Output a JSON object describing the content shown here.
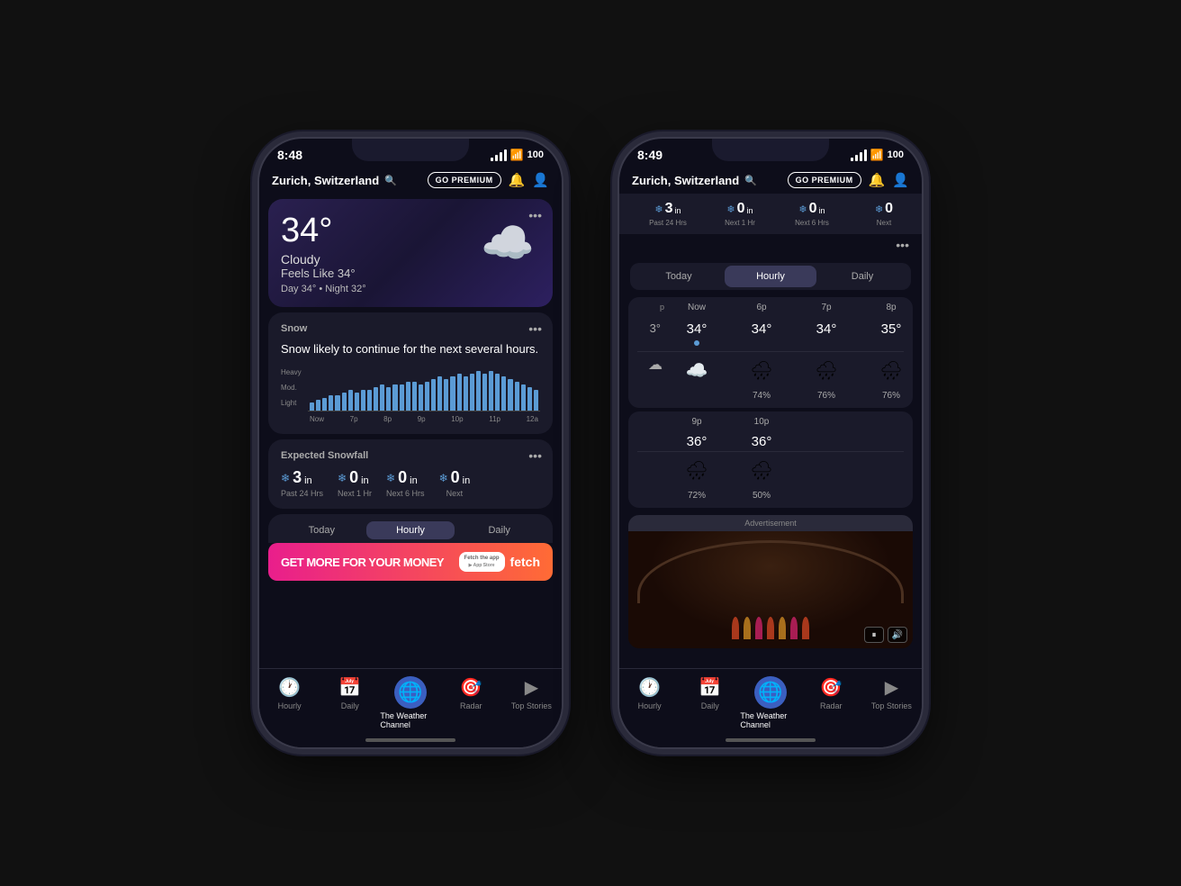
{
  "phone1": {
    "status": {
      "time": "8:48",
      "battery": "100"
    },
    "header": {
      "location": "Zurich, Switzerland",
      "premium_label": "GO PREMIUM"
    },
    "weather": {
      "temperature": "34°",
      "condition": "Cloudy",
      "feels_like": "Feels Like 34°",
      "day_temp": "Day 34°",
      "night_temp": "Night 32°"
    },
    "snow_alert": {
      "title": "Snow",
      "description": "Snow likely to continue for the next several hours."
    },
    "chart": {
      "y_labels": [
        "Heavy",
        "Mod.",
        "Light"
      ],
      "x_labels": [
        "Now",
        "7p",
        "8p",
        "9p",
        "10p",
        "11p",
        "12a"
      ],
      "bars": [
        3,
        4,
        5,
        6,
        6,
        7,
        8,
        7,
        8,
        8,
        9,
        10,
        9,
        10,
        10,
        11,
        11,
        10,
        11,
        12,
        13,
        12,
        13,
        14,
        13,
        14,
        15,
        14,
        15,
        14,
        13,
        12,
        11,
        10,
        9,
        8
      ]
    },
    "snowfall": {
      "title": "Expected Snowfall",
      "amounts": [
        {
          "value": "3",
          "unit": "in",
          "label": "Past 24 Hrs"
        },
        {
          "value": "0",
          "unit": "in",
          "label": "Next 1 Hr"
        },
        {
          "value": "0",
          "unit": "in",
          "label": "Next 6 Hrs"
        },
        {
          "value": "0",
          "unit": "in",
          "label": "Next"
        }
      ]
    },
    "tabs": {
      "items": [
        "Today",
        "Hourly",
        "Daily"
      ],
      "active": "Hourly"
    },
    "ad": {
      "text": "GET MORE FOR YOUR MONEY",
      "cta": "Fetch the app",
      "brand": "fetch"
    },
    "nav": {
      "items": [
        {
          "label": "Hourly",
          "icon": "🕐"
        },
        {
          "label": "Daily",
          "icon": "📅"
        },
        {
          "label": "TWC",
          "icon": "🌐"
        },
        {
          "label": "Radar",
          "icon": "🎯"
        },
        {
          "label": "Top Stories",
          "icon": "▶"
        }
      ],
      "active_index": 2
    }
  },
  "phone2": {
    "status": {
      "time": "8:49",
      "battery": "100"
    },
    "header": {
      "location": "Zurich, Switzerland",
      "premium_label": "GO PREMIUM"
    },
    "snow_strip": [
      {
        "value": "3",
        "unit": "in",
        "label": "Past 24 Hrs"
      },
      {
        "value": "0",
        "unit": "in",
        "label": "Next 1 Hr"
      },
      {
        "value": "0",
        "unit": "in",
        "label": "Next 6 Hrs"
      },
      {
        "value": "0",
        "unit": "in",
        "label": "Next"
      }
    ],
    "view_selector": {
      "tabs": [
        "Today",
        "Hourly",
        "Daily"
      ],
      "active": "Hourly"
    },
    "hourly": {
      "columns": [
        {
          "time": "p",
          "temp": "3°",
          "precip": "",
          "partial": true
        },
        {
          "time": "Now",
          "temp": "34°",
          "precip": ""
        },
        {
          "time": "6p",
          "temp": "34°",
          "precip": "74%"
        },
        {
          "time": "7p",
          "temp": "34°",
          "precip": "76%"
        },
        {
          "time": "8p",
          "temp": "35°",
          "precip": "76%"
        },
        {
          "time": "9p",
          "temp": "36°",
          "precip": "72%"
        },
        {
          "time": "10p",
          "temp": "36°",
          "precip": "50%"
        }
      ]
    },
    "ad": {
      "label": "Advertisement"
    },
    "nav": {
      "items": [
        {
          "label": "Hourly",
          "icon": "🕐"
        },
        {
          "label": "Daily",
          "icon": "📅"
        },
        {
          "label": "TWC",
          "icon": "🌐"
        },
        {
          "label": "Radar",
          "icon": "🎯"
        },
        {
          "label": "Top Stories",
          "icon": "▶"
        }
      ],
      "active_index": 2
    }
  }
}
